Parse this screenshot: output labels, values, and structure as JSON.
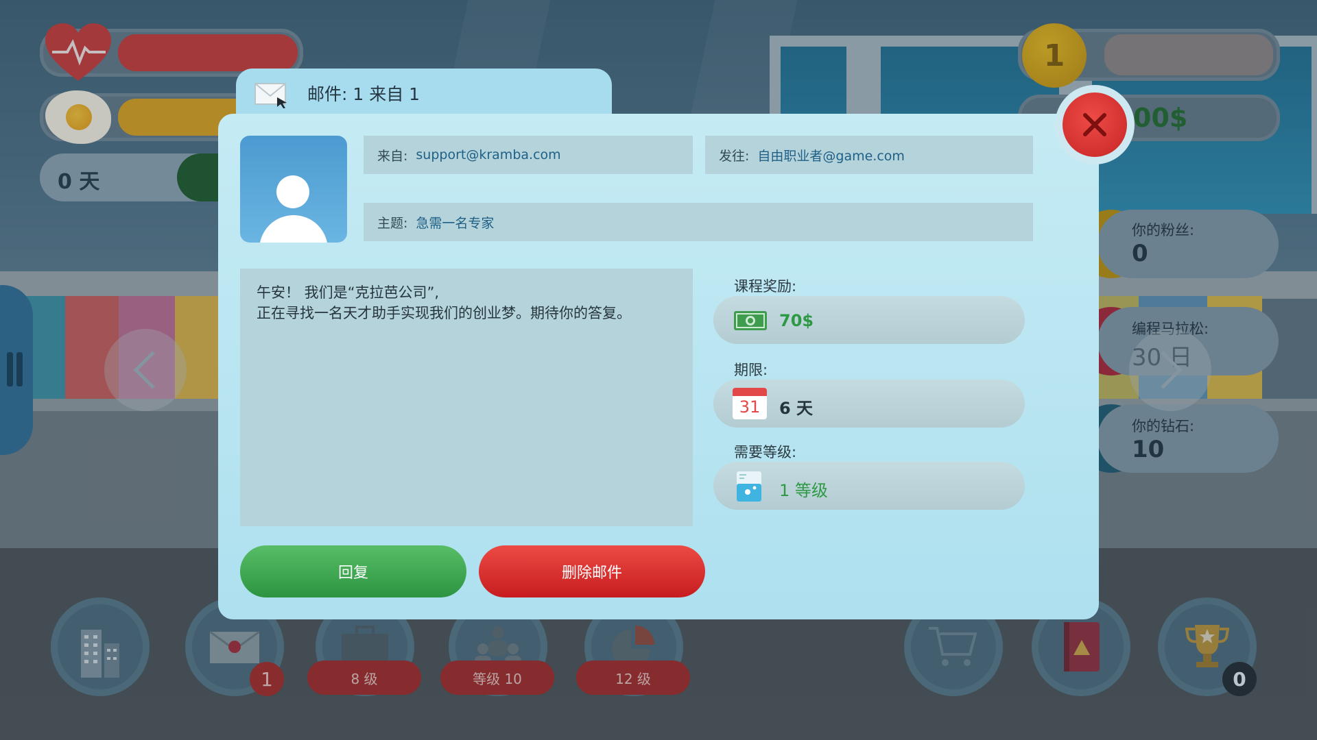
{
  "hud": {
    "days": "0 天",
    "coin_count": "1",
    "money": "00$",
    "stats": [
      {
        "label": "你的粉丝:",
        "value": "0"
      },
      {
        "label": "编程马拉松:",
        "value": "30 日"
      },
      {
        "label": "你的钻石:",
        "value": "10"
      }
    ]
  },
  "bottom_nav": {
    "mail_badge": "1",
    "levels": [
      "8 级",
      "等级 10",
      "12 级"
    ],
    "trophy_badge": "0"
  },
  "mail": {
    "tab_title": "邮件: 1 来自 1",
    "from_label": "来自:",
    "from_value": "support@kramba.com",
    "to_label": "发往:",
    "to_value": "自由职业者@game.com",
    "subject_label": "主题:",
    "subject_value": "急需一名专家",
    "body_line1": "午安！ 我们是“克拉芭公司”,",
    "body_line2": "正在寻找一名天才助手实现我们的创业梦。期待你的答复。",
    "reward_label": "课程奖励:",
    "reward_value": "70$",
    "deadline_label": "期限:",
    "deadline_value": "6 天",
    "calendar_day": "31",
    "level_label": "需要等级:",
    "level_value": "1 等级",
    "reply_button": "回复",
    "delete_button": "删除邮件"
  },
  "colors": {
    "accent_green": "#2e9944",
    "delete_red": "#c71c1f",
    "link_blue": "#1f5f86",
    "dialog_bg": "#b8e4f1"
  },
  "icons": [
    "heart-icon",
    "egg-icon",
    "mail-icon",
    "close-icon",
    "money-icon",
    "calendar-icon",
    "beaker-icon",
    "building-icon",
    "briefcase-icon",
    "team-icon",
    "chart-icon",
    "cart-icon",
    "book-icon",
    "trophy-icon"
  ]
}
